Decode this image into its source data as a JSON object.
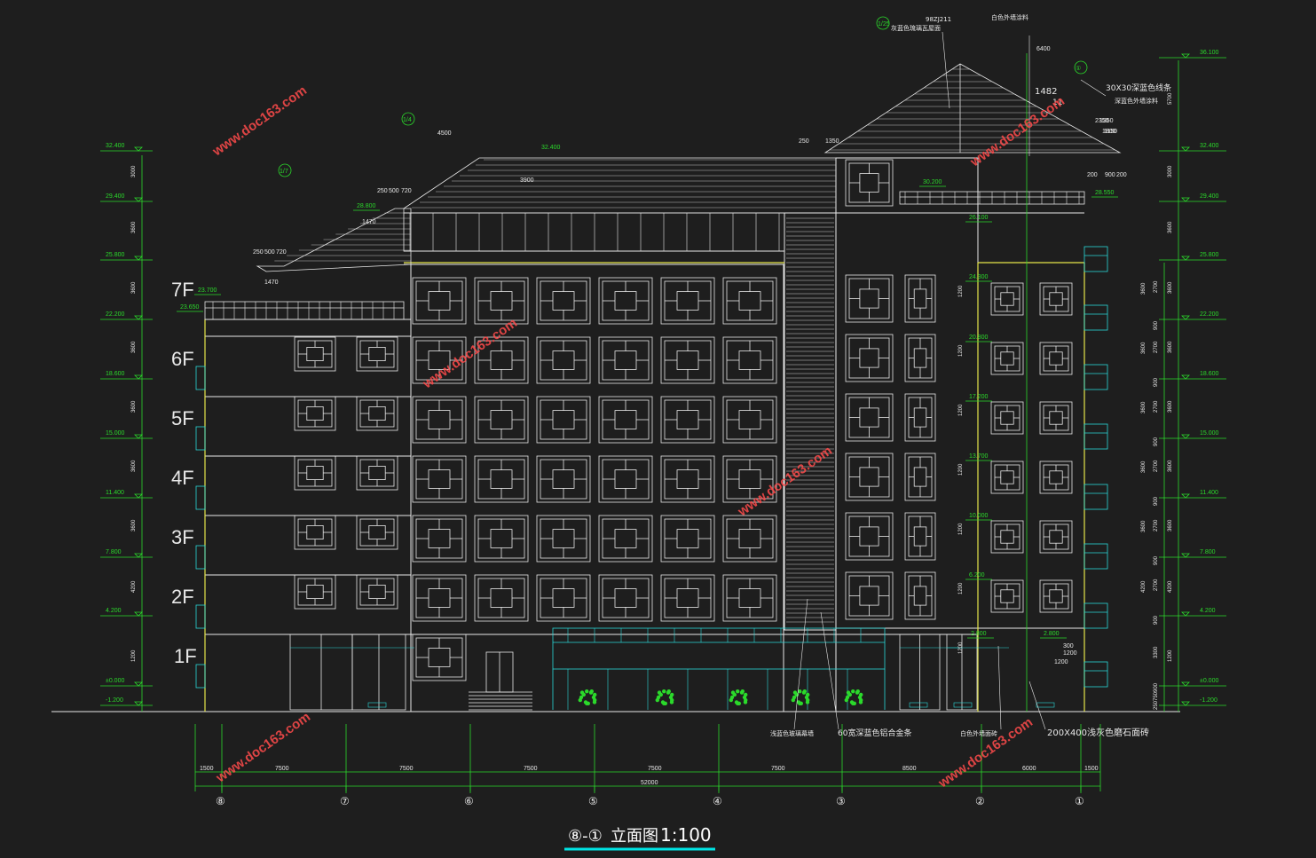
{
  "drawing": {
    "title": "立面图",
    "title_axes": "⑧-①",
    "scale": "1:100"
  },
  "floors": [
    "7F",
    "6F",
    "5F",
    "4F",
    "3F",
    "2F",
    "1F"
  ],
  "levels_left": [
    "32.400",
    "29.400",
    "25.800",
    "22.200",
    "18.600",
    "15.000",
    "11.400",
    "7.800",
    "4.200",
    "±0.000",
    "-1.200"
  ],
  "levels_right": [
    "36.100",
    "32.400",
    "29.400",
    "25.800",
    "22.200",
    "18.600",
    "15.000",
    "11.400",
    "7.800",
    "4.200",
    "±0.000",
    "-1.200"
  ],
  "levels_inner": [
    "23.700",
    "23.650",
    "28.800",
    "30.200",
    "28.550",
    "26.100",
    "24.300",
    "20.800",
    "17.200",
    "13.700",
    "10.000",
    "6.200",
    "2.800",
    "2.800"
  ],
  "top_levels": [
    "32.400"
  ],
  "dims_left_vertical": [
    "3000",
    "3600",
    "3600",
    "3600",
    "3600",
    "3600",
    "3600",
    "4200",
    "1200"
  ],
  "dims_right_vertical": [
    "5700",
    "3000",
    "3600",
    "3600",
    "3600",
    "3600",
    "3600",
    "3600",
    "4200",
    "1200"
  ],
  "dims_right_inner": [
    "2700",
    "900",
    "2700",
    "900",
    "2700",
    "900",
    "2700",
    "900",
    "2700",
    "900",
    "2700",
    "900",
    "3300",
    "900",
    "750",
    "250"
  ],
  "dims_right_inner2": [
    "3600",
    "3600",
    "3600",
    "3600",
    "3600",
    "4200"
  ],
  "dims_window_heights": [
    "1200",
    "1200",
    "1200",
    "1200",
    "1200",
    "1200",
    "1200"
  ],
  "dims_roof": [
    "4500",
    "3900",
    "1350",
    "1800",
    "250",
    "500",
    "720",
    "1470",
    "1470",
    "250",
    "500",
    "720",
    "250",
    "1350",
    "6400",
    "2350",
    "1150",
    "200",
    "900",
    "200",
    "1200",
    "1200",
    "300"
  ],
  "dims_bottom_segments": [
    "1500",
    "7500",
    "7500",
    "7500",
    "7500",
    "7500",
    "8500",
    "6000",
    "1500"
  ],
  "dims_bottom_total": "52000",
  "axes": [
    "⑧",
    "⑦",
    "⑥",
    "⑤",
    "④",
    "③",
    "②",
    "①"
  ],
  "roof_tags": [
    "1/4",
    "1/7",
    "1/25",
    "①"
  ],
  "notes": {
    "roof_top_1": "98ZJ211",
    "roof_top_2": "灰蓝色琉璃瓦屋面",
    "roof_right_1": "白色外墙涂料",
    "roof_right_2": "1482",
    "roof_right_3": "11",
    "roof_right_4": "30X30深蓝色线条",
    "roof_right_5": "深蓝色外墙涂料",
    "bottom_1": "浅蓝色玻璃幕墙",
    "bottom_2": "60宽深蓝色铝合金条",
    "bottom_3": "白色外墙面砖",
    "bottom_4": "200X400浅灰色磨石面砖"
  },
  "watermark": "www.doc163.com",
  "colors": {
    "background": "#1e1e1e",
    "lines": "#e8e8e8",
    "dimension_green": "#2bd92b",
    "edge_yellow": "#e6e64a",
    "glass_cyan": "#2ad7d7",
    "watermark_red": "#ff4b4b",
    "underline_cyan": "#00e5e5"
  }
}
